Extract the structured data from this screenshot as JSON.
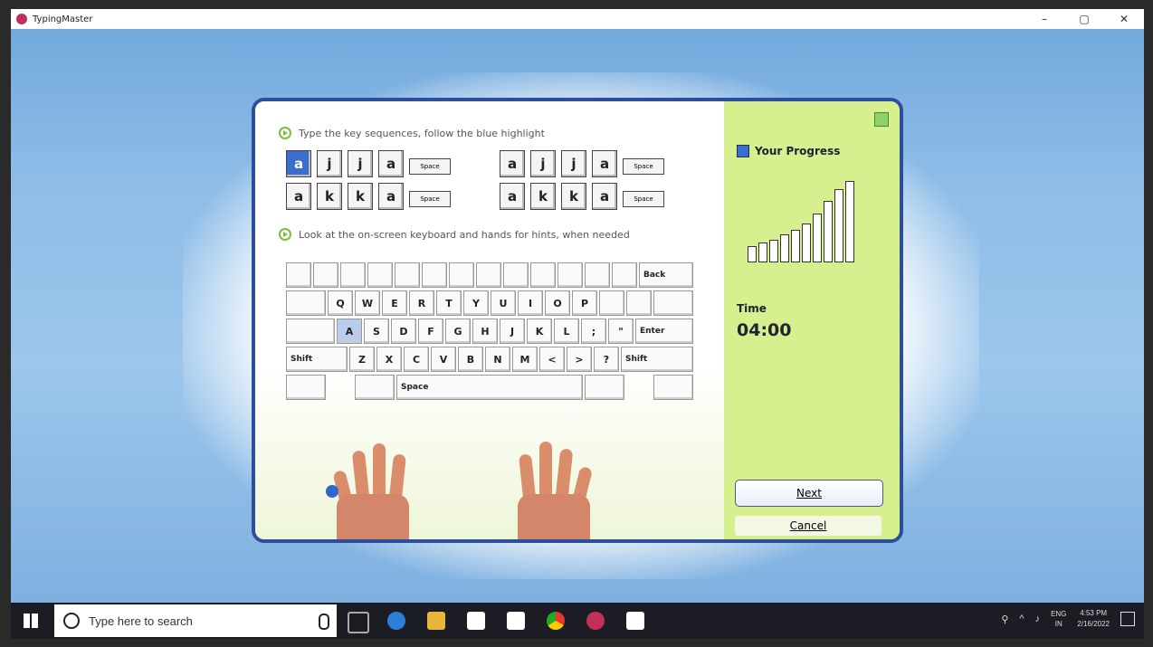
{
  "window": {
    "title": "TypingMaster",
    "controls": {
      "minimize": "–",
      "maximize": "▢",
      "close": "✕"
    }
  },
  "dialog": {
    "instruction1": "Type the key sequences, follow the blue highlight",
    "instruction2": "Look at the on-screen keyboard and hands for hints, when needed",
    "sequences": [
      {
        "keys": [
          "a",
          "j",
          "j",
          "a"
        ],
        "space": "Space",
        "highlight_index": 0
      },
      {
        "keys": [
          "a",
          "j",
          "j",
          "a"
        ],
        "space": "Space",
        "highlight_index": -1
      },
      {
        "keys": [
          "a",
          "k",
          "k",
          "a"
        ],
        "space": "Space",
        "highlight_index": -1
      },
      {
        "keys": [
          "a",
          "k",
          "k",
          "a"
        ],
        "space": "Space",
        "highlight_index": -1
      }
    ],
    "keyboard": {
      "row1_back": "Back",
      "row2": [
        "Q",
        "W",
        "E",
        "R",
        "T",
        "Y",
        "U",
        "I",
        "O",
        "P"
      ],
      "row3": [
        "A",
        "S",
        "D",
        "F",
        "G",
        "H",
        "J",
        "K",
        "L",
        ";",
        "\""
      ],
      "row3_enter": "Enter",
      "row4_shift_left": "Shift",
      "row4": [
        "Z",
        "X",
        "C",
        "V",
        "B",
        "N",
        "M",
        "<",
        ">",
        "?"
      ],
      "row4_shift_right": "Shift",
      "space": "Space",
      "active_key": "A"
    },
    "progress": {
      "title": "Your Progress",
      "bar_levels": [
        0.2,
        0.24,
        0.28,
        0.34,
        0.4,
        0.48,
        0.6,
        0.76,
        0.9,
        1.0
      ]
    },
    "time_label": "Time",
    "time_value": "04:00",
    "next_label": "Next",
    "cancel_label": "Cancel"
  },
  "taskbar": {
    "search_placeholder": "Type here to search",
    "lang_line1": "ENG",
    "lang_line2": "IN",
    "time": "4:53 PM",
    "date": "2/16/2022"
  }
}
